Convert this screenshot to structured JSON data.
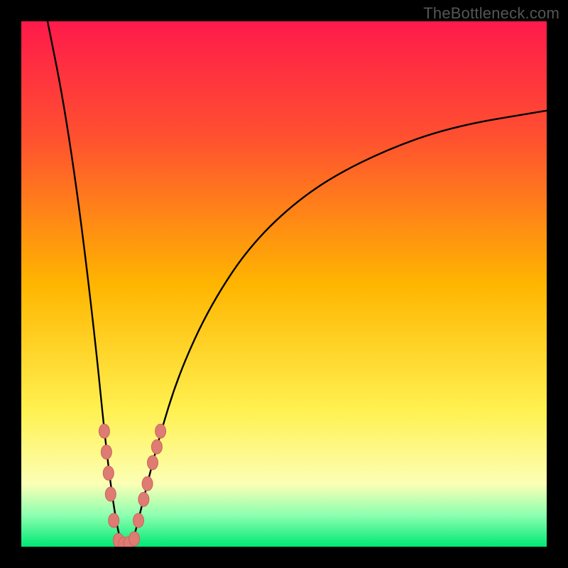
{
  "watermark": "TheBottleneck.com",
  "colors": {
    "frame": "#000000",
    "curve": "#000000",
    "marker_fill": "#de7b72",
    "marker_stroke": "#c9655c",
    "grad_top": "#ff1a4b",
    "grad_upper": "#ff5030",
    "grad_mid": "#ffb500",
    "grad_yellow": "#fff150",
    "grad_pale": "#fcffb5",
    "grad_green_light": "#8dffb0",
    "grad_green": "#00e874"
  },
  "chart_data": {
    "type": "line",
    "title": "",
    "xlabel": "",
    "ylabel": "",
    "xlim": [
      0,
      100
    ],
    "ylim": [
      0,
      100
    ],
    "x_min_point": 19,
    "description": "V-shaped bottleneck curve. Value falls steeply from ~100 at x≈5 to ~0 at x≈19, then rises concavely toward ~83 at x≈100.",
    "series": [
      {
        "name": "bottleneck_curve",
        "points": [
          {
            "x": 5,
            "y": 100
          },
          {
            "x": 8,
            "y": 85
          },
          {
            "x": 11,
            "y": 65
          },
          {
            "x": 14,
            "y": 40
          },
          {
            "x": 16,
            "y": 20
          },
          {
            "x": 17.5,
            "y": 8
          },
          {
            "x": 19,
            "y": 0
          },
          {
            "x": 21,
            "y": 0
          },
          {
            "x": 23,
            "y": 8
          },
          {
            "x": 26,
            "y": 20
          },
          {
            "x": 30,
            "y": 33
          },
          {
            "x": 36,
            "y": 46
          },
          {
            "x": 44,
            "y": 58
          },
          {
            "x": 55,
            "y": 68
          },
          {
            "x": 68,
            "y": 75
          },
          {
            "x": 82,
            "y": 80
          },
          {
            "x": 100,
            "y": 83
          }
        ]
      }
    ],
    "markers": [
      {
        "x": 15.8,
        "y": 22
      },
      {
        "x": 16.2,
        "y": 18
      },
      {
        "x": 16.6,
        "y": 14
      },
      {
        "x": 17.0,
        "y": 10
      },
      {
        "x": 17.6,
        "y": 5
      },
      {
        "x": 18.5,
        "y": 1.2
      },
      {
        "x": 19.5,
        "y": 0.5
      },
      {
        "x": 20.5,
        "y": 0.6
      },
      {
        "x": 21.5,
        "y": 1.5
      },
      {
        "x": 22.3,
        "y": 5
      },
      {
        "x": 23.3,
        "y": 9
      },
      {
        "x": 24.0,
        "y": 12
      },
      {
        "x": 25.0,
        "y": 16
      },
      {
        "x": 25.8,
        "y": 19
      },
      {
        "x": 26.5,
        "y": 22
      }
    ]
  }
}
